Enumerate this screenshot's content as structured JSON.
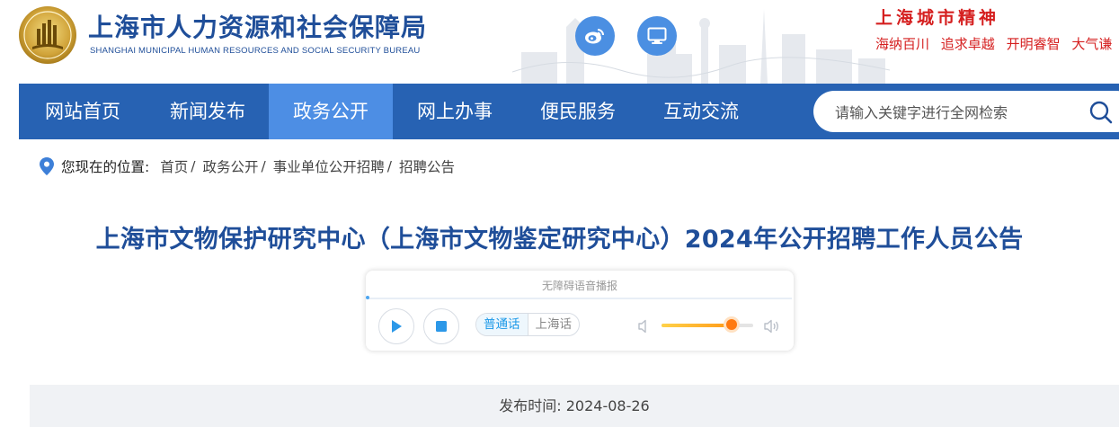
{
  "header": {
    "site_name": "上海市人力资源和社会保障局",
    "site_name_en": "SHANGHAI MUNICIPAL HUMAN RESOURCES AND SOCIAL SECURITY BUREAU",
    "social_icons": [
      "weibo-icon",
      "monitor-icon"
    ],
    "spirit_title": "上海城市精神",
    "spirit_words": [
      "海纳百川",
      "追求卓越",
      "开明睿智",
      "大气谦"
    ],
    "colors": {
      "brand_blue": "#1f4e99",
      "spirit_red": "#d51f1f"
    }
  },
  "nav": {
    "items": [
      {
        "label": "网站首页",
        "active": false
      },
      {
        "label": "新闻发布",
        "active": false
      },
      {
        "label": "政务公开",
        "active": true
      },
      {
        "label": "网上办事",
        "active": false
      },
      {
        "label": "便民服务",
        "active": false
      },
      {
        "label": "互动交流",
        "active": false
      }
    ],
    "search_placeholder": "请输入关键字进行全网检索",
    "colors": {
      "bar": "#2762b3",
      "active": "#4d8ee4"
    }
  },
  "breadcrumb": {
    "label": "您现在的位置:",
    "items": [
      "首页",
      "政务公开",
      "事业单位公开招聘",
      "招聘公告"
    ],
    "separator": "/"
  },
  "article": {
    "title": "上海市文物保护研究中心（上海市文物鉴定研究中心）2024年公开招聘工作人员公告",
    "publish_label": "发布时间:",
    "publish_date": "2024-08-26"
  },
  "player": {
    "title": "无障碍语音播报",
    "languages": [
      {
        "label": "普通话",
        "active": true
      },
      {
        "label": "上海话",
        "active": false
      }
    ],
    "volume_level": 0.76
  }
}
